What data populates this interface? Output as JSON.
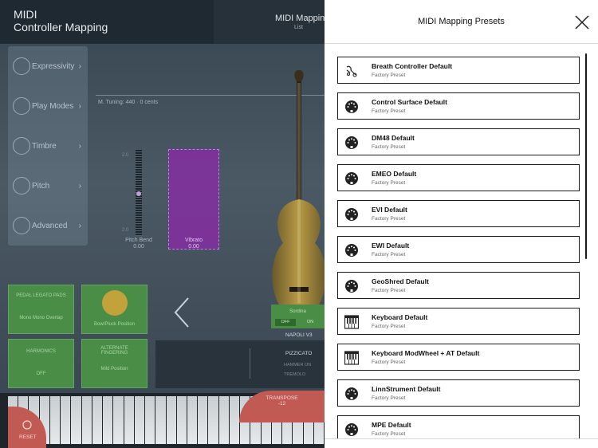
{
  "app": {
    "title_line1": "MIDI",
    "title_line2": "Controller Mapping",
    "mode": "MIDI Mapping",
    "mode_sub": "List"
  },
  "sidebar": {
    "items": [
      {
        "label": "Expressivity",
        "icon": "heart-shield-icon"
      },
      {
        "label": "Play Modes",
        "icon": "sliders-icon"
      },
      {
        "label": "Timbre",
        "icon": "radio-waves-icon"
      },
      {
        "label": "Pitch",
        "icon": "tuning-fork-icon"
      },
      {
        "label": "Advanced",
        "icon": "gear-icon"
      }
    ]
  },
  "instrument": {
    "tuning": "M. Tuning: 440 · 0 cents",
    "pitch_bend_label": "Pitch Bend",
    "pitch_bend_value": "0.00",
    "vibrato_label": "Vibrato",
    "vibrato_value": "0.00",
    "scale_top": "2.0",
    "scale_bottom": "2.0",
    "string_name": "NAPOLI V3",
    "articulation": "PIZZICATO",
    "articulation_sub1": "HAMMER ON",
    "articulation_sub2": "TREMOLO",
    "sordina_label": "Sordina",
    "sordina_off": "OFF",
    "sordina_on": "ON",
    "tiles": [
      {
        "title": "PEDAL LEGATO PADS",
        "value": "Mono Mono Overlap"
      },
      {
        "title": "",
        "value": "Bow/Pluck Position"
      },
      {
        "title": "HARMONICS",
        "value": "OFF"
      },
      {
        "title": "ALTERNATE FINGERING",
        "value": "Mild Position"
      }
    ],
    "transpose_label": "TRANSPOSE",
    "transpose_value": "-12",
    "reset_label": "RESET"
  },
  "panel": {
    "title": "MIDI Mapping Presets",
    "presets": [
      {
        "name": "Breath Controller Default",
        "sub": "Factory Preset",
        "icon": "breath-controller-icon"
      },
      {
        "name": "Control Surface Default",
        "sub": "Factory Preset",
        "icon": "midi-port-icon"
      },
      {
        "name": "DM48 Default",
        "sub": "Factory Preset",
        "icon": "midi-port-icon"
      },
      {
        "name": "EMEO Default",
        "sub": "Factory Preset",
        "icon": "midi-port-icon"
      },
      {
        "name": "EVI Default",
        "sub": "Factory Preset",
        "icon": "midi-port-icon"
      },
      {
        "name": "EWI Default",
        "sub": "Factory Preset",
        "icon": "midi-port-icon"
      },
      {
        "name": "GeoShred Default",
        "sub": "Factory Preset",
        "icon": "midi-port-icon"
      },
      {
        "name": "Keyboard Default",
        "sub": "Factory Preset",
        "icon": "keyboard-icon"
      },
      {
        "name": "Keyboard ModWheel + AT Default",
        "sub": "Factory Preset",
        "icon": "keyboard-icon"
      },
      {
        "name": "LinnStrument Default",
        "sub": "Factory Preset",
        "icon": "midi-port-icon"
      },
      {
        "name": "MPE Default",
        "sub": "Factory Preset",
        "icon": "midi-port-icon"
      }
    ]
  },
  "colors": {
    "accent_purple": "#8c28aa",
    "accent_green": "#4a8d47",
    "accent_red": "#c15a52"
  }
}
